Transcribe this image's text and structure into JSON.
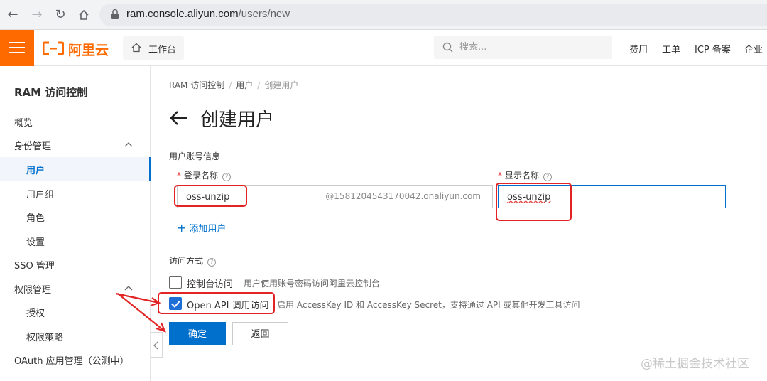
{
  "browser": {
    "url_host": "ram.console.aliyun.com",
    "url_path": "/users/new"
  },
  "header": {
    "logo_text": "阿里云",
    "workbench_label": "工作台",
    "search_placeholder": "搜索...",
    "links": [
      "费用",
      "工单",
      "ICP 备案",
      "企业"
    ],
    "accent_color": "#ff6a00"
  },
  "sidebar": {
    "title": "RAM 访问控制",
    "items": [
      {
        "label": "概览",
        "level": 1
      },
      {
        "label": "身份管理",
        "level": 1,
        "expanded": true
      },
      {
        "label": "用户",
        "level": 2,
        "active": true
      },
      {
        "label": "用户组",
        "level": 2
      },
      {
        "label": "角色",
        "level": 2
      },
      {
        "label": "设置",
        "level": 2
      },
      {
        "label": "SSO 管理",
        "level": 1
      },
      {
        "label": "权限管理",
        "level": 1,
        "expanded": true
      },
      {
        "label": "授权",
        "level": 2
      },
      {
        "label": "权限策略",
        "level": 2
      },
      {
        "label": "OAuth 应用管理（公测中）",
        "level": 1
      }
    ]
  },
  "breadcrumb": {
    "items": [
      "RAM 访问控制",
      "用户",
      "创建用户"
    ]
  },
  "page": {
    "title": "创建用户",
    "account_section_label": "用户账号信息",
    "login_name_label": "登录名称",
    "login_name_value": "oss-unzip",
    "login_suffix": "@1581204543170042.onaliyun.com",
    "display_name_label": "显示名称",
    "display_name_value": "oss-unzip",
    "add_user_label": "添加用户",
    "access_section_label": "访问方式",
    "console_access_label": "控制台访问",
    "console_access_desc": "用户使用账号密码访问阿里云控制台",
    "console_access_checked": false,
    "api_access_label": "Open API 调用访问",
    "api_access_desc": "启用 AccessKey ID 和 AccessKey Secret，支持通过 API 或其他开发工具访问",
    "api_access_checked": true,
    "confirm_label": "确定",
    "back_label": "返回",
    "primary_color": "#0070cc"
  },
  "watermark": "@稀土掘金技术社区"
}
